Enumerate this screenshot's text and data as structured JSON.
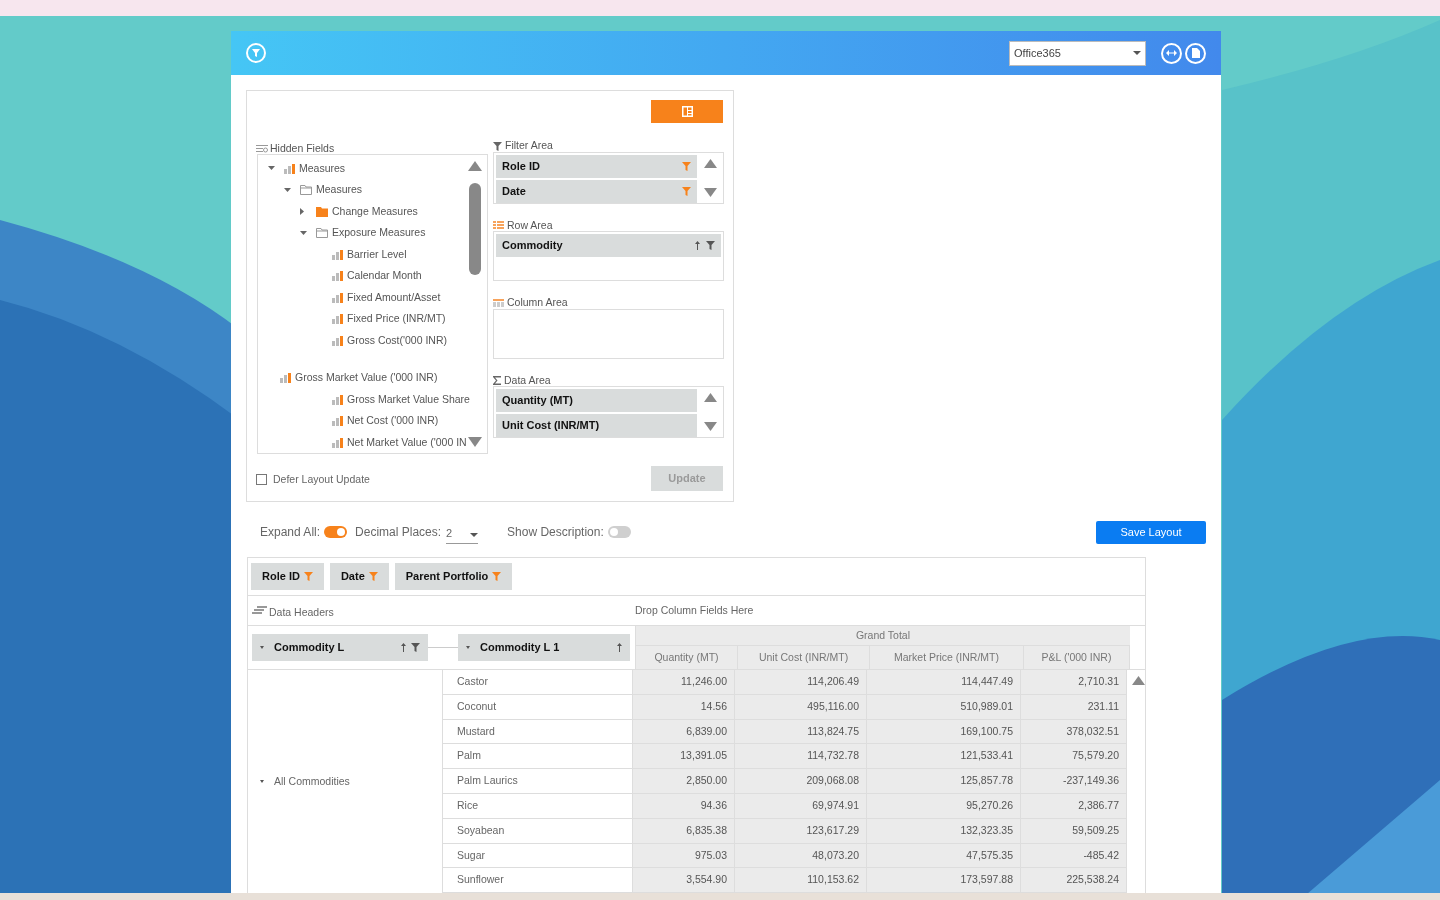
{
  "header": {
    "dropdown": {
      "value": "Office365"
    }
  },
  "field_list": {
    "hidden_fields": {
      "label": "Hidden Fields",
      "tree": [
        {
          "label": "Measures",
          "kind": "measure",
          "expanded": true,
          "children": [
            {
              "label": "Measures",
              "kind": "folder",
              "expanded": true,
              "children": [
                {
                  "label": "Change Measures",
                  "kind": "folder-filled",
                  "expanded": false
                },
                {
                  "label": "Exposure Measures",
                  "kind": "folder",
                  "expanded": true,
                  "children": [
                    {
                      "label": "Barrier Level",
                      "kind": "measure"
                    },
                    {
                      "label": "Calendar Month",
                      "kind": "measure"
                    },
                    {
                      "label": "Fixed Amount/Asset",
                      "kind": "measure"
                    },
                    {
                      "label": "Fixed Price (INR/MT)",
                      "kind": "measure"
                    },
                    {
                      "label": "Gross Cost('000 INR)",
                      "kind": "measure"
                    }
                  ]
                },
                {
                  "label": "Gross Market Value ('000 INR)",
                  "kind": "measure",
                  "gap": true
                },
                {
                  "label": "Gross Market Value Share",
                  "kind": "measure",
                  "indent": true
                },
                {
                  "label": "Net Cost ('000 INR)",
                  "kind": "measure",
                  "indent": true
                },
                {
                  "label": "Net Market Value ('000 IN",
                  "kind": "measure",
                  "indent": true
                }
              ]
            }
          ]
        }
      ]
    },
    "filter_area": {
      "label": "Filter Area",
      "fields": [
        {
          "name": "Role ID",
          "filtered": true
        },
        {
          "name": "Date",
          "filtered": true
        }
      ]
    },
    "row_area": {
      "label": "Row Area",
      "fields": [
        {
          "name": "Commodity",
          "filtered": false
        }
      ]
    },
    "column_area": {
      "label": "Column Area"
    },
    "data_area": {
      "label": "Data Area",
      "fields": [
        {
          "name": "Quantity (MT)"
        },
        {
          "name": "Unit Cost (INR/MT)"
        }
      ]
    },
    "defer": {
      "label": "Defer Layout Update",
      "checked": false
    },
    "update_button": {
      "label": "Update",
      "disabled": true
    }
  },
  "options": {
    "expand_all": {
      "label": "Expand All:",
      "on": true
    },
    "decimal_places": {
      "label": "Decimal Places:",
      "value": "2"
    },
    "show_description": {
      "label": "Show Description:",
      "on": false
    },
    "save_button": "Save Layout"
  },
  "pivot": {
    "filter_fields": [
      "Role ID",
      "Date",
      "Parent Portfolio"
    ],
    "data_headers": "Data Headers",
    "drop_columns": "Drop Column Fields Here",
    "row_fields": [
      {
        "name": "Commodity L",
        "filter": true
      },
      {
        "name": "Commodity L 1",
        "filter": false
      }
    ],
    "grand_total": "Grand Total",
    "columns": [
      "Quantity (MT)",
      "Unit Cost (INR/MT)",
      "Market Price (INR/MT)",
      "P&L ('000 INR)"
    ],
    "group": "All Commodities",
    "rows": [
      {
        "name": "Castor",
        "values": [
          "11,246.00",
          "114,206.49",
          "114,447.49",
          "2,710.31"
        ]
      },
      {
        "name": "Coconut",
        "values": [
          "14.56",
          "495,116.00",
          "510,989.01",
          "231.11"
        ]
      },
      {
        "name": "Mustard",
        "values": [
          "6,839.00",
          "113,824.75",
          "169,100.75",
          "378,032.51"
        ]
      },
      {
        "name": "Palm",
        "values": [
          "13,391.05",
          "114,732.78",
          "121,533.41",
          "75,579.20"
        ]
      },
      {
        "name": "Palm Laurics",
        "values": [
          "2,850.00",
          "209,068.08",
          "125,857.78",
          "-237,149.36"
        ]
      },
      {
        "name": "Rice",
        "values": [
          "94.36",
          "69,974.91",
          "95,270.26",
          "2,386.77"
        ]
      },
      {
        "name": "Soyabean",
        "values": [
          "6,835.38",
          "123,617.29",
          "132,323.35",
          "59,509.25"
        ]
      },
      {
        "name": "Sugar",
        "values": [
          "975.03",
          "48,073.20",
          "47,575.35",
          "-485.42"
        ]
      },
      {
        "name": "Sunflower",
        "values": [
          "3,554.90",
          "110,153.62",
          "173,597.88",
          "225,538.24"
        ]
      }
    ]
  }
}
